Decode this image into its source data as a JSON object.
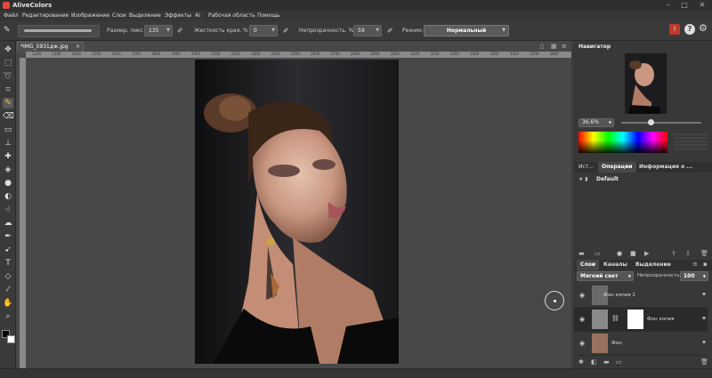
{
  "app": {
    "title": "AliveColors"
  },
  "menu": [
    "Файл",
    "Редактирование",
    "Изображение",
    "Слои",
    "Выделение",
    "Эффекты",
    "AI",
    "Рабочая область",
    "Помощь"
  ],
  "toolbar": {
    "size_label": "Размер, пикс",
    "size_value": "135",
    "hardness_label": "Жесткость края, %",
    "hardness_value": "0",
    "opacity_label": "Непрозрачность, %",
    "opacity_value": "59",
    "mode_label": "Режим:",
    "mode_value": "Нормальный"
  },
  "document": {
    "tab_label": "*IMG_5931дж.jpg",
    "ruler_ticks": [
      "1200",
      "1300",
      "1400",
      "1500",
      "1600",
      "1700",
      "1800",
      "1900",
      "2000",
      "2100",
      "2200",
      "2300",
      "2400",
      "2500",
      "2600",
      "2700",
      "2800",
      "2900",
      "3000",
      "3100",
      "3200",
      "3300",
      "3400",
      "3500",
      "3600",
      "3700",
      "3800"
    ]
  },
  "navigator": {
    "title": "Навигатор",
    "zoom": "36.6%"
  },
  "history_panel": {
    "tabs": [
      "Ист...",
      "Операции",
      "Информация о ..."
    ],
    "active_tab": "Операции",
    "items": [
      "Default"
    ]
  },
  "layers_panel": {
    "tabs": [
      "Слои",
      "Каналы",
      "Выделение"
    ],
    "active_tab": "Слои",
    "blend_mode": "Мягкий свет",
    "opacity_label": "Непрозрачность",
    "opacity_value": "100",
    "layers": [
      {
        "name": "Фон копия 2"
      },
      {
        "name": "Фон копия"
      },
      {
        "name": "Фон"
      }
    ]
  },
  "colors": {
    "accent": "#e04a3a",
    "panel_bg": "#383838",
    "canvas_bg": "#484848"
  }
}
